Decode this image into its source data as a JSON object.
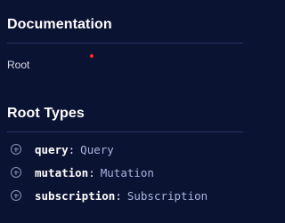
{
  "documentation": {
    "title": "Documentation",
    "breadcrumb": "Root"
  },
  "root_types": {
    "title": "Root Types",
    "items": [
      {
        "field": "query",
        "colon": ":",
        "type": "Query",
        "icon": "plus-circle-icon"
      },
      {
        "field": "mutation",
        "colon": ":",
        "type": "Mutation",
        "icon": "plus-circle-icon"
      },
      {
        "field": "subscription",
        "colon": ":",
        "type": "Subscription",
        "icon": "plus-circle-icon"
      }
    ]
  },
  "colors": {
    "background": "#0b1333",
    "divider": "#2a3560",
    "type_name": "#a9b4e0",
    "cursor_dot": "#ff2a2a"
  }
}
